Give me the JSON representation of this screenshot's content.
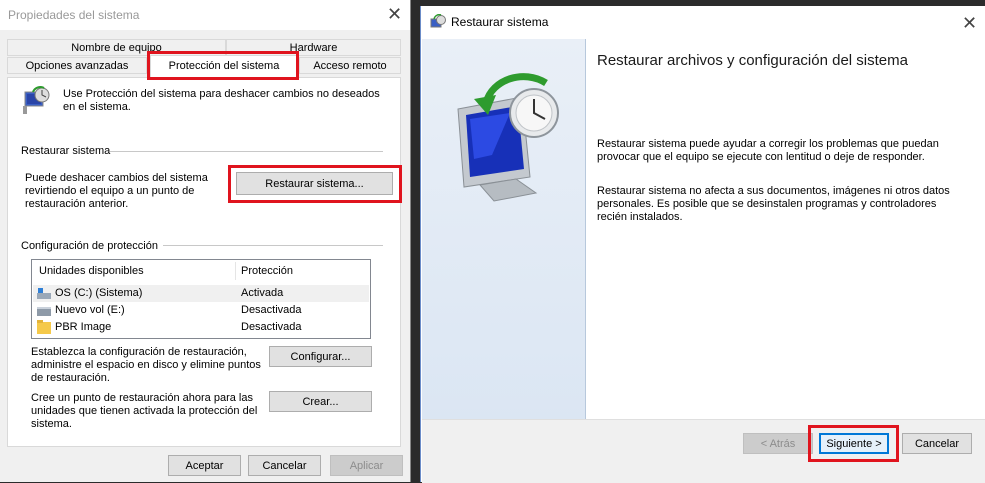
{
  "left_window": {
    "title": "Propiedades del sistema",
    "tabs_row1": [
      "Nombre de equipo",
      "Hardware"
    ],
    "tabs_row2": [
      "Opciones avanzadas",
      "Protección del sistema",
      "Acceso remoto"
    ],
    "intro_text_1": "Use Protección del sistema para deshacer cambios no deseados",
    "intro_text_2": "en el sistema.",
    "restore_section_title": "Restaurar sistema",
    "restore_desc_1": "Puede deshacer cambios del sistema",
    "restore_desc_2": "revirtiendo el equipo a un punto de",
    "restore_desc_3": "restauración anterior.",
    "restore_button": "Restaurar sistema...",
    "protection_section_title": "Configuración de protección",
    "table_headers": [
      "Unidades disponibles",
      "Protección"
    ],
    "table_rows": [
      {
        "drive": "OS (C:) (Sistema)",
        "protection": "Activada"
      },
      {
        "drive": "Nuevo vol (E:)",
        "protection": "Desactivada"
      },
      {
        "drive": "PBR Image",
        "protection": "Desactivada"
      }
    ],
    "config_desc_1": "Establezca la configuración de restauración,",
    "config_desc_2": "administre el espacio en disco y elimine puntos",
    "config_desc_3": "de restauración.",
    "config_button": "Configurar...",
    "create_desc_1": "Cree un punto de restauración ahora para las",
    "create_desc_2": "unidades que tienen activada la protección del",
    "create_desc_3": "sistema.",
    "create_button": "Crear...",
    "ok_button": "Aceptar",
    "cancel_button": "Cancelar",
    "apply_button": "Aplicar"
  },
  "right_window": {
    "title": "Restaurar sistema",
    "heading": "Restaurar archivos y configuración del sistema",
    "para1_line1": "Restaurar sistema puede ayudar a corregir los problemas que puedan",
    "para1_line2": "provocar que el equipo se ejecute con lentitud o deje de responder.",
    "para2_line1": "Restaurar sistema no afecta a sus documentos, imágenes ni otros datos",
    "para2_line2": "personales. Es posible que se desinstalen programas y controladores",
    "para2_line3": "recién instalados.",
    "back_button": "< Atrás",
    "next_button": "Siguiente >",
    "cancel_button": "Cancelar"
  },
  "colors": {
    "highlight": "#e0141e",
    "accent": "#0078d7"
  }
}
